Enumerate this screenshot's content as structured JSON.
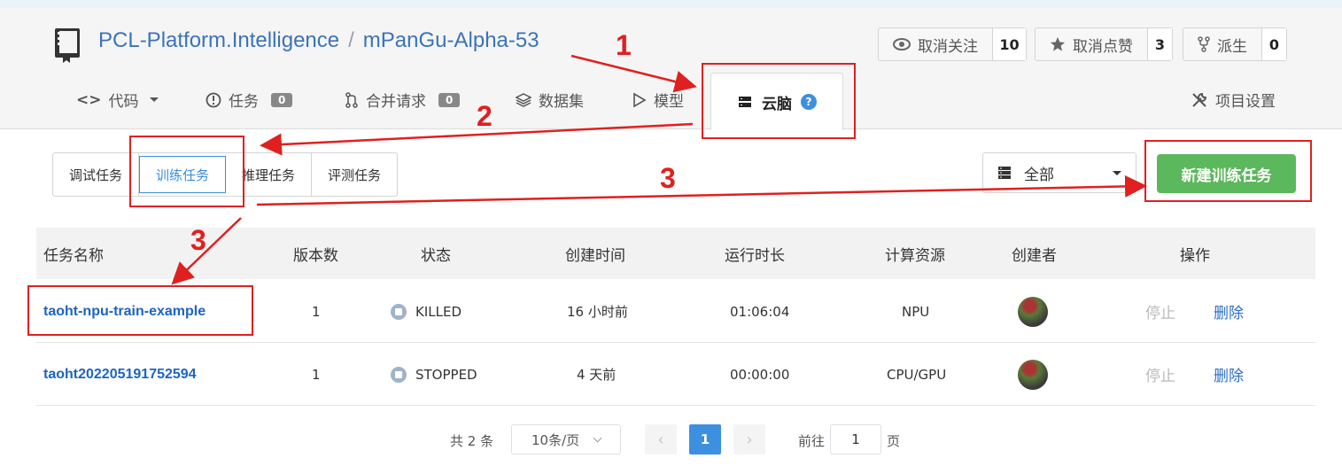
{
  "repo": {
    "owner": "PCL-Platform.Intelligence",
    "separator": "/",
    "name": "mPanGu-Alpha-53"
  },
  "stats": [
    {
      "label": "取消关注",
      "count": "10",
      "icon": "eye-icon"
    },
    {
      "label": "取消点赞",
      "count": "3",
      "icon": "star-icon"
    },
    {
      "label": "派生",
      "count": "0",
      "icon": "fork-icon"
    }
  ],
  "tabs": {
    "code": {
      "label": "代码",
      "icon": "code-icon"
    },
    "issues": {
      "label": "任务",
      "badge": "0",
      "icon": "info-circle-icon"
    },
    "pulls": {
      "label": "合并请求",
      "badge": "0",
      "icon": "merge-icon"
    },
    "datasets": {
      "label": "数据集",
      "icon": "layers-icon"
    },
    "models": {
      "label": "模型",
      "icon": "play-icon"
    },
    "cloudbrain": {
      "label": "云脑",
      "help": "?",
      "icon": "server-icon"
    },
    "settings": {
      "label": "项目设置",
      "icon": "tools-icon"
    }
  },
  "task_types": [
    "调试任务",
    "训练任务",
    "推理任务",
    "评测任务"
  ],
  "filter": {
    "label": "全部",
    "icon": "server-icon"
  },
  "new_button": "新建训练任务",
  "table": {
    "headers": [
      "任务名称",
      "版本数",
      "状态",
      "创建时间",
      "运行时长",
      "计算资源",
      "创建者",
      "操作"
    ],
    "rows": [
      {
        "name": "taoht-npu-train-example",
        "versions": "1",
        "status": "KILLED",
        "created": "16 小时前",
        "duration": "01:06:04",
        "resource": "NPU",
        "stop": "停止",
        "delete": "删除"
      },
      {
        "name": "taoht202205191752594",
        "versions": "1",
        "status": "STOPPED",
        "created": "4 天前",
        "duration": "00:00:00",
        "resource": "CPU/GPU",
        "stop": "停止",
        "delete": "删除"
      }
    ]
  },
  "pagination": {
    "total": "共 2 条",
    "page_size": "10条/页",
    "prev": "‹",
    "current": "1",
    "next": "›",
    "goto_label": "前往",
    "goto_value": "1",
    "page_unit": "页"
  },
  "annotations": {
    "n1": "1",
    "n2": "2",
    "n3a": "3",
    "n3b": "3"
  },
  "colors": {
    "link": "#3b73b9",
    "accent": "#3d8fe0",
    "success": "#5cb85c",
    "annotation": "#e02020"
  }
}
